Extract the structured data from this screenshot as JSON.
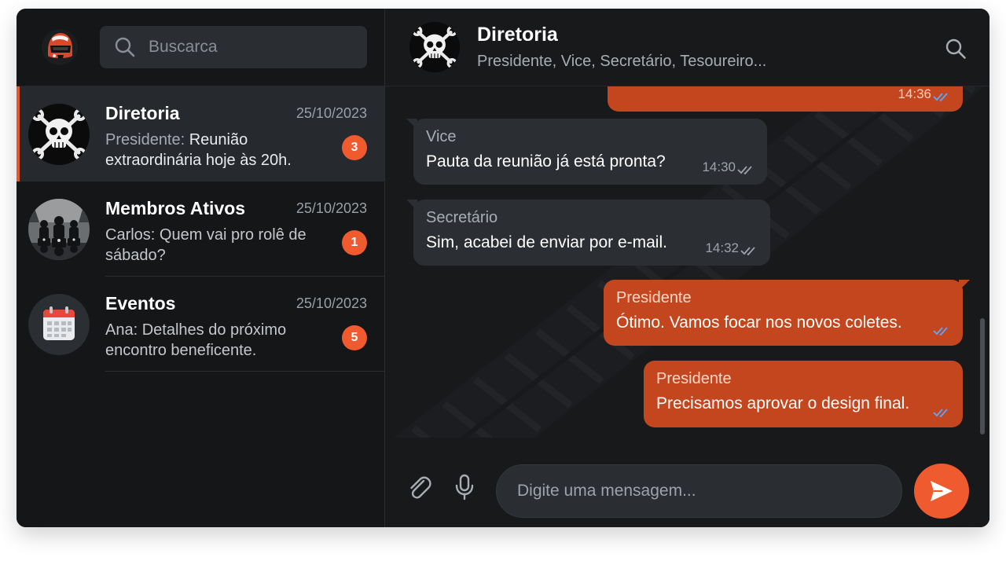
{
  "sidebar": {
    "search": {
      "placeholder": "Buscarca",
      "icon": "search-icon"
    },
    "chats": [
      {
        "name": "Diretoria",
        "date": "25/10/2023",
        "sender": "Presidente:",
        "preview": " Reunião extraordinária hoje às 20h.",
        "unread": "3",
        "active": true
      },
      {
        "name": "Membros Ativos",
        "date": "25/10/2023",
        "sender": "",
        "preview": "Carlos: Quem vai pro rolê de sábado?",
        "unread": "1",
        "active": false
      },
      {
        "name": "Eventos",
        "date": "25/10/2023",
        "sender": "",
        "preview": "Ana: Detalhes do próximo encontro beneficente.",
        "unread": "5",
        "active": false
      }
    ]
  },
  "conversation": {
    "title": "Diretoria",
    "subtitle": "Presidente, Vice, Secretário, Tesoureiro...",
    "messages": [
      {
        "direction": "out",
        "author": "",
        "text": "",
        "time": "14:36",
        "status": "read"
      },
      {
        "direction": "in",
        "author": "Vice",
        "text": "Pauta da reunião já está pronta?",
        "time": "14:30",
        "status": "delivered"
      },
      {
        "direction": "in",
        "author": "Secretário",
        "text": "Sim, acabei de enviar por e-mail.",
        "time": "14:32",
        "status": "delivered"
      },
      {
        "direction": "out",
        "author": "Presidente",
        "text": "Ótimo. Vamos focar nos novos coletes.",
        "time": "",
        "status": "read"
      },
      {
        "direction": "out",
        "author": "Presidente",
        "text": "Precisamos aprovar o design final.",
        "time": "",
        "status": "read"
      }
    ],
    "composer": {
      "placeholder": "Digite uma mensagem...",
      "attach_icon": "paperclip-icon",
      "mic_icon": "microphone-icon",
      "send_icon": "send-icon"
    }
  },
  "colors": {
    "accent": "#f05a2f",
    "outgoing_bubble": "#c4461f",
    "incoming_bubble": "#2b2e33",
    "background": "#18191b",
    "read_ticks": "#5aa7ff"
  }
}
